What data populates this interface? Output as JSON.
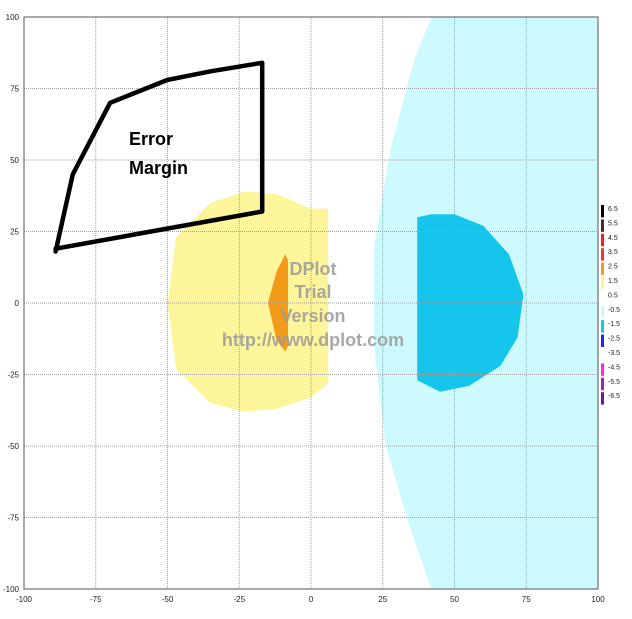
{
  "chart_data": {
    "type": "contour",
    "xlim": [
      -100,
      100
    ],
    "ylim": [
      -100,
      100
    ],
    "x_ticks": [
      -100,
      -75,
      -50,
      -25,
      0,
      25,
      50,
      75,
      100
    ],
    "y_ticks": [
      -100,
      -75,
      -50,
      -25,
      0,
      25,
      50,
      75,
      100
    ],
    "grid": true,
    "annotation": {
      "lines": [
        "Error",
        "Margin"
      ],
      "outline": [
        [
          -89,
          18
        ],
        [
          -83,
          45
        ],
        [
          -70,
          70
        ],
        [
          -50,
          78
        ],
        [
          -35,
          81
        ],
        [
          -17,
          84
        ],
        [
          -17,
          32
        ],
        [
          -89,
          19
        ]
      ]
    },
    "watermark": [
      "DPlot",
      "Trial",
      "Version",
      "http://www.dplot.com"
    ],
    "regions": [
      {
        "level": "0.5 to 1.5",
        "color": "#fdf59a",
        "points": [
          [
            -23,
            39
          ],
          [
            -12,
            38
          ],
          [
            0,
            33
          ],
          [
            6,
            33
          ],
          [
            6,
            -28
          ],
          [
            0,
            -33
          ],
          [
            -12,
            -37
          ],
          [
            -23,
            -38
          ],
          [
            -35,
            -35
          ],
          [
            -47,
            -23
          ],
          [
            -50,
            0
          ],
          [
            -47,
            23
          ],
          [
            -35,
            35
          ]
        ]
      },
      {
        "level": "1.5 to 2.5",
        "color": "#f29a1a",
        "points": [
          [
            -9,
            17
          ],
          [
            -8,
            15
          ],
          [
            -8,
            -15
          ],
          [
            -9,
            -17
          ],
          [
            -12,
            -13
          ],
          [
            -15,
            0
          ],
          [
            -12,
            11
          ]
        ]
      },
      {
        "level": "-1.5 to -0.5",
        "color": "#ccfaff",
        "points": [
          [
            42,
            100
          ],
          [
            100,
            100
          ],
          [
            100,
            -100
          ],
          [
            42,
            -100
          ],
          [
            35,
            -80
          ],
          [
            26,
            -50
          ],
          [
            22,
            -15
          ],
          [
            22,
            20
          ],
          [
            28,
            55
          ],
          [
            36,
            85
          ]
        ]
      },
      {
        "level": "-2.5 to -1.5",
        "color": "#15c5ec",
        "points": [
          [
            37,
            30
          ],
          [
            42,
            31
          ],
          [
            50,
            31
          ],
          [
            60,
            27
          ],
          [
            69,
            17
          ],
          [
            74,
            3
          ],
          [
            72,
            -12
          ],
          [
            66,
            -22
          ],
          [
            55,
            -29
          ],
          [
            45,
            -31
          ],
          [
            37,
            -27
          ]
        ]
      }
    ],
    "colorbar": [
      {
        "label": "6.5",
        "color": "#000000"
      },
      {
        "label": "5.5",
        "color": "#4a2a2a"
      },
      {
        "label": "4.5",
        "color": "#ff1b1b"
      },
      {
        "label": "3.5",
        "color": "#ee3a2a"
      },
      {
        "label": "2.5",
        "color": "#f29a1a"
      },
      {
        "label": "1.5",
        "color": "#fdf59a"
      },
      {
        "label": "0.5",
        "color": "#ffffff"
      },
      {
        "label": "-0.5",
        "color": "#ccfaff"
      },
      {
        "label": "-1.5",
        "color": "#15c5ec"
      },
      {
        "label": "-2.5",
        "color": "#2424ff"
      },
      {
        "label": "-3.5",
        "color": "#ffffff"
      },
      {
        "label": "-4.5",
        "color": "#ff22ff"
      },
      {
        "label": "-5.5",
        "color": "#a020c0"
      },
      {
        "label": "-6.5",
        "color": "#6a1aa0"
      }
    ]
  }
}
